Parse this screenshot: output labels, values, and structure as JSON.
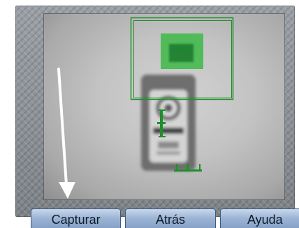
{
  "buttons": {
    "capture_label": "Capturar",
    "back_label": "Atrás",
    "help_label": "Ayuda"
  },
  "overlay": {
    "guide_color": "#1f8f2a",
    "target_fill": "#41b84a",
    "arrow_color": "#ffffff"
  },
  "icons": {
    "arrow": "arrow-down-icon"
  }
}
